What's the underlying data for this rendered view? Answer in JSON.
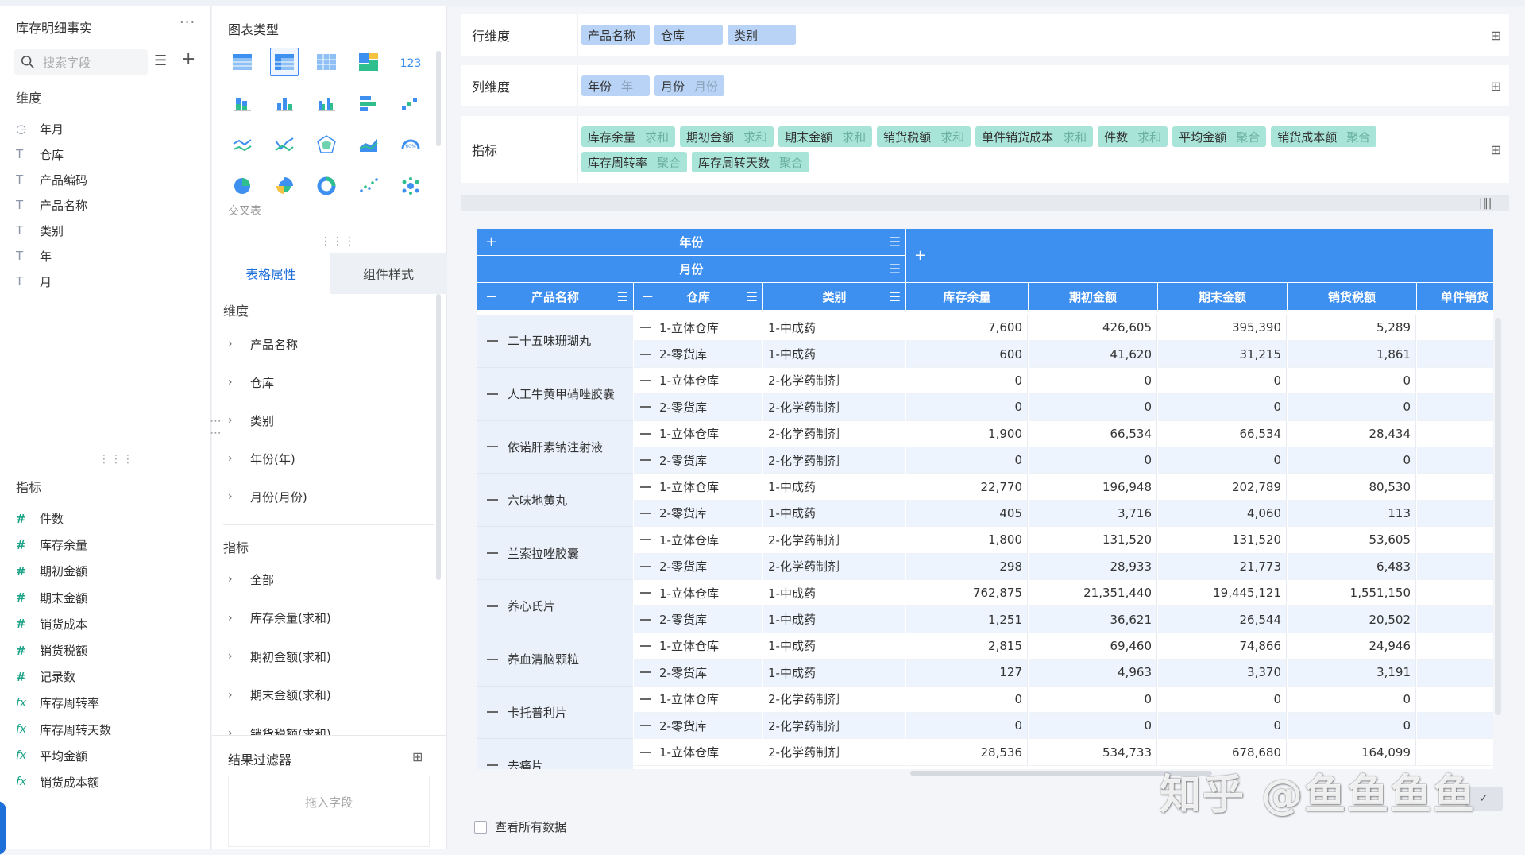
{
  "left_panel": {
    "title": "库存明细事实",
    "more": "···",
    "search_placeholder": "搜索字段",
    "dimension_header": "维度",
    "dimensions": [
      {
        "icon": "clock-icon",
        "glyph": "◷",
        "label": "年月"
      },
      {
        "icon": "text-icon",
        "glyph": "T",
        "label": "仓库"
      },
      {
        "icon": "text-icon",
        "glyph": "T",
        "label": "产品编码"
      },
      {
        "icon": "text-icon",
        "glyph": "T",
        "label": "产品名称"
      },
      {
        "icon": "text-icon",
        "glyph": "T",
        "label": "类别"
      },
      {
        "icon": "text-icon",
        "glyph": "T",
        "label": "年"
      },
      {
        "icon": "text-icon",
        "glyph": "T",
        "label": "月"
      }
    ],
    "measure_header": "指标",
    "measures": [
      {
        "icon": "hash-icon",
        "glyph": "#",
        "label": "件数"
      },
      {
        "icon": "hash-icon",
        "glyph": "#",
        "label": "库存余量"
      },
      {
        "icon": "hash-icon",
        "glyph": "#",
        "label": "期初金额"
      },
      {
        "icon": "hash-icon",
        "glyph": "#",
        "label": "期末金额"
      },
      {
        "icon": "hash-icon",
        "glyph": "#",
        "label": "销货成本"
      },
      {
        "icon": "hash-icon",
        "glyph": "#",
        "label": "销货税额"
      },
      {
        "icon": "hash-icon",
        "glyph": "#",
        "label": "记录数"
      },
      {
        "icon": "formula-icon",
        "glyph": "fx",
        "label": "库存周转率"
      },
      {
        "icon": "formula-icon",
        "glyph": "fx",
        "label": "库存周转天数"
      },
      {
        "icon": "formula-icon",
        "glyph": "fx",
        "label": "平均金额"
      },
      {
        "icon": "formula-icon",
        "glyph": "fx",
        "label": "销货成本额"
      }
    ]
  },
  "middle_panel": {
    "chart_type_title": "图表类型",
    "cross_table_label": "交叉表",
    "tab_table_props": "表格属性",
    "tab_component_style": "组件样式",
    "dim_header": "维度",
    "dims": [
      "产品名称",
      "仓库",
      "类别",
      "年份(年)",
      "月份(月份)"
    ],
    "measure_header": "指标",
    "measures": [
      "全部",
      "库存余量(求和)",
      "期初金额(求和)",
      "期末金额(求和)",
      "销货税额(求和)"
    ],
    "result_filter": "结果过滤器",
    "drop_hint": "拖入字段"
  },
  "config": {
    "row_dim_label": "行维度",
    "row_dims": [
      "产品名称",
      "仓库",
      "类别"
    ],
    "col_dim_label": "列维度",
    "col_dims": [
      {
        "name": "年份",
        "sub": "年"
      },
      {
        "name": "月份",
        "sub": "月份"
      }
    ],
    "measure_label": "指标",
    "measures": [
      {
        "name": "库存余量",
        "agg": "求和"
      },
      {
        "name": "期初金额",
        "agg": "求和"
      },
      {
        "name": "期末金额",
        "agg": "求和"
      },
      {
        "name": "销货税额",
        "agg": "求和"
      },
      {
        "name": "单件销货成本",
        "agg": "求和"
      },
      {
        "name": "件数",
        "agg": "求和"
      },
      {
        "name": "平均金额",
        "agg": "聚合"
      },
      {
        "name": "销货成本额",
        "agg": "聚合"
      },
      {
        "name": "库存周转率",
        "agg": "聚合"
      },
      {
        "name": "库存周转天数",
        "agg": "聚合"
      }
    ]
  },
  "table": {
    "header_year": "年份",
    "header_month": "月份",
    "plus": "+",
    "col_headers": [
      "产品名称",
      "仓库",
      "类别",
      "库存余量",
      "期初金额",
      "期末金额",
      "销货税额",
      "单件销货"
    ],
    "products": [
      {
        "name": "二十五味珊瑚丸",
        "rows": [
          [
            "1-立体仓库",
            "1-中成药",
            "7,600",
            "426,605",
            "395,390",
            "5,289"
          ],
          [
            "2-零货库",
            "1-中成药",
            "600",
            "41,620",
            "31,215",
            "1,861"
          ]
        ]
      },
      {
        "name": "人工牛黄甲硝唑胶囊",
        "rows": [
          [
            "1-立体仓库",
            "2-化学药制剂",
            "0",
            "0",
            "0",
            "0"
          ],
          [
            "2-零货库",
            "2-化学药制剂",
            "0",
            "0",
            "0",
            "0"
          ]
        ]
      },
      {
        "name": "依诺肝素钠注射液",
        "rows": [
          [
            "1-立体仓库",
            "2-化学药制剂",
            "1,900",
            "66,534",
            "66,534",
            "28,434"
          ],
          [
            "2-零货库",
            "2-化学药制剂",
            "0",
            "0",
            "0",
            "0"
          ]
        ]
      },
      {
        "name": "六味地黄丸",
        "rows": [
          [
            "1-立体仓库",
            "1-中成药",
            "22,770",
            "196,948",
            "202,789",
            "80,530"
          ],
          [
            "2-零货库",
            "1-中成药",
            "405",
            "3,716",
            "4,060",
            "113"
          ]
        ]
      },
      {
        "name": "兰索拉唑胶囊",
        "rows": [
          [
            "1-立体仓库",
            "2-化学药制剂",
            "1,800",
            "131,520",
            "131,520",
            "53,605"
          ],
          [
            "2-零货库",
            "2-化学药制剂",
            "298",
            "28,933",
            "21,773",
            "6,483"
          ]
        ]
      },
      {
        "name": "养心氏片",
        "rows": [
          [
            "1-立体仓库",
            "1-中成药",
            "762,875",
            "21,351,440",
            "19,445,121",
            "1,551,150"
          ],
          [
            "2-零货库",
            "1-中成药",
            "1,251",
            "36,621",
            "26,544",
            "20,502"
          ]
        ]
      },
      {
        "name": "养血清脑颗粒",
        "rows": [
          [
            "1-立体仓库",
            "1-中成药",
            "2,815",
            "69,460",
            "74,866",
            "24,946"
          ],
          [
            "2-零货库",
            "1-中成药",
            "127",
            "4,963",
            "3,370",
            "3,191"
          ]
        ]
      },
      {
        "name": "卡托普利片",
        "rows": [
          [
            "1-立体仓库",
            "2-化学药制剂",
            "0",
            "0",
            "0",
            "0"
          ],
          [
            "2-零货库",
            "2-化学药制剂",
            "0",
            "0",
            "0",
            "0"
          ]
        ]
      },
      {
        "name": "去痛片",
        "rows": [
          [
            "1-立体仓库",
            "2-化学药制剂",
            "28,536",
            "534,733",
            "678,680",
            "164,099"
          ]
        ]
      }
    ]
  },
  "footer": {
    "view_all": "查看所有数据",
    "watermark": "知乎 @鱼鱼鱼鱼"
  },
  "colors": {
    "accent": "#3d8ff0",
    "measure_chip": "#a8e4d8",
    "dim_chip": "#b8d3f5"
  }
}
